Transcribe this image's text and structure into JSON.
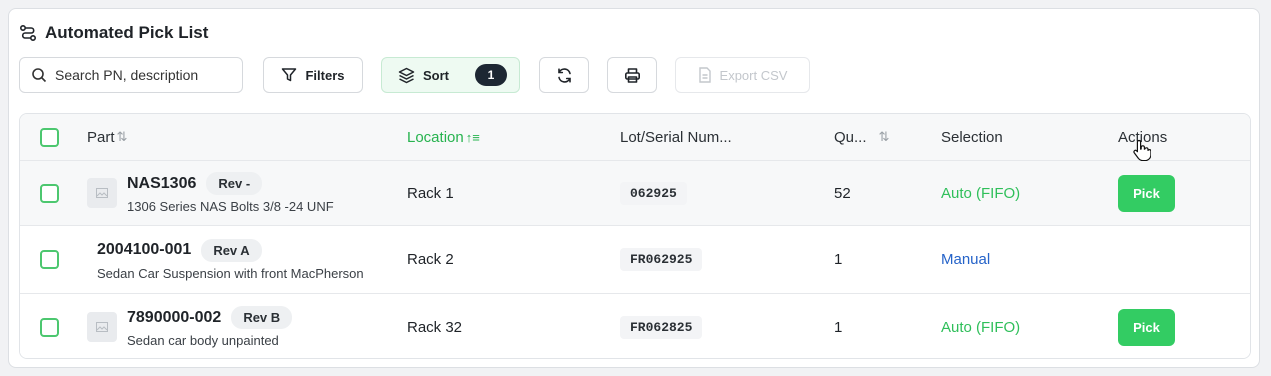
{
  "header": {
    "title": "Automated Pick List",
    "icon": "route-icon"
  },
  "toolbar": {
    "search_placeholder": "Search PN, description",
    "filters_label": "Filters",
    "sort_label": "Sort",
    "sort_count": "1",
    "export_label": "Export CSV"
  },
  "table": {
    "columns": [
      "Part",
      "Location",
      "Lot/Serial Num...",
      "Qu...",
      "Selection",
      "Actions"
    ],
    "rows": [
      {
        "pn": "NAS1306",
        "rev": "Rev -",
        "desc": "1306 Series NAS Bolts 3/8 -24 UNF",
        "location": "Rack 1",
        "lot": "062925",
        "qty": "52",
        "selection": "Auto (FIFO)",
        "action": "Pick"
      },
      {
        "pn": "2004100-001",
        "rev": "Rev A",
        "desc": "Sedan Car Suspension with front MacPherson",
        "location": "Rack 2",
        "lot": "FR062925",
        "qty": "1",
        "selection": "Manual",
        "action": ""
      },
      {
        "pn": "7890000-002",
        "rev": "Rev B",
        "desc": "Sedan car body unpainted",
        "location": "Rack 32",
        "lot": "FR062825",
        "qty": "1",
        "selection": "Auto (FIFO)",
        "action": "Pick"
      }
    ]
  },
  "colors": {
    "accent_green": "#33cc63",
    "link_blue": "#2563c9",
    "sort_badge": "#1d2733"
  }
}
